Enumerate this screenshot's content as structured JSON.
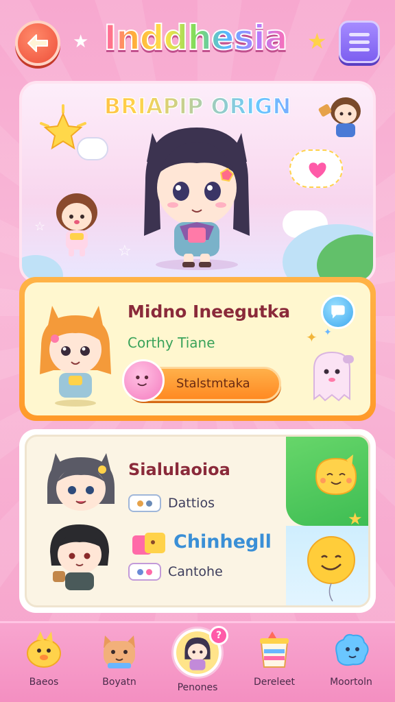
{
  "header": {
    "title": "Inddhesia"
  },
  "hero": {
    "banner_title": "BRIAPIP ORIGN"
  },
  "card1": {
    "name": "Midno Ineegutka",
    "subtitle": "Corthy Tiane",
    "button_label": "Stalstmtaka"
  },
  "card2": {
    "name": "Sialulaoioa",
    "row1_label": "Dattios",
    "name2": "Chinhegll",
    "row2_label": "Cantohe"
  },
  "bottom_nav": {
    "items": [
      {
        "label": "Baeos",
        "icon": "duck-icon"
      },
      {
        "label": "Boyatn",
        "icon": "cat-icon"
      },
      {
        "label": "Penones",
        "icon": "character-portrait-icon",
        "active": true,
        "badge": "?"
      },
      {
        "label": "Dereleet",
        "icon": "paint-bucket-icon"
      },
      {
        "label": "Moortoln",
        "icon": "blue-blob-icon"
      }
    ]
  },
  "colors": {
    "background": "#f7a8cf",
    "card1_frame": "#ff9a2a",
    "card2_accent": "#3ebd53",
    "title_gradient_start": "#ff5fa8"
  }
}
